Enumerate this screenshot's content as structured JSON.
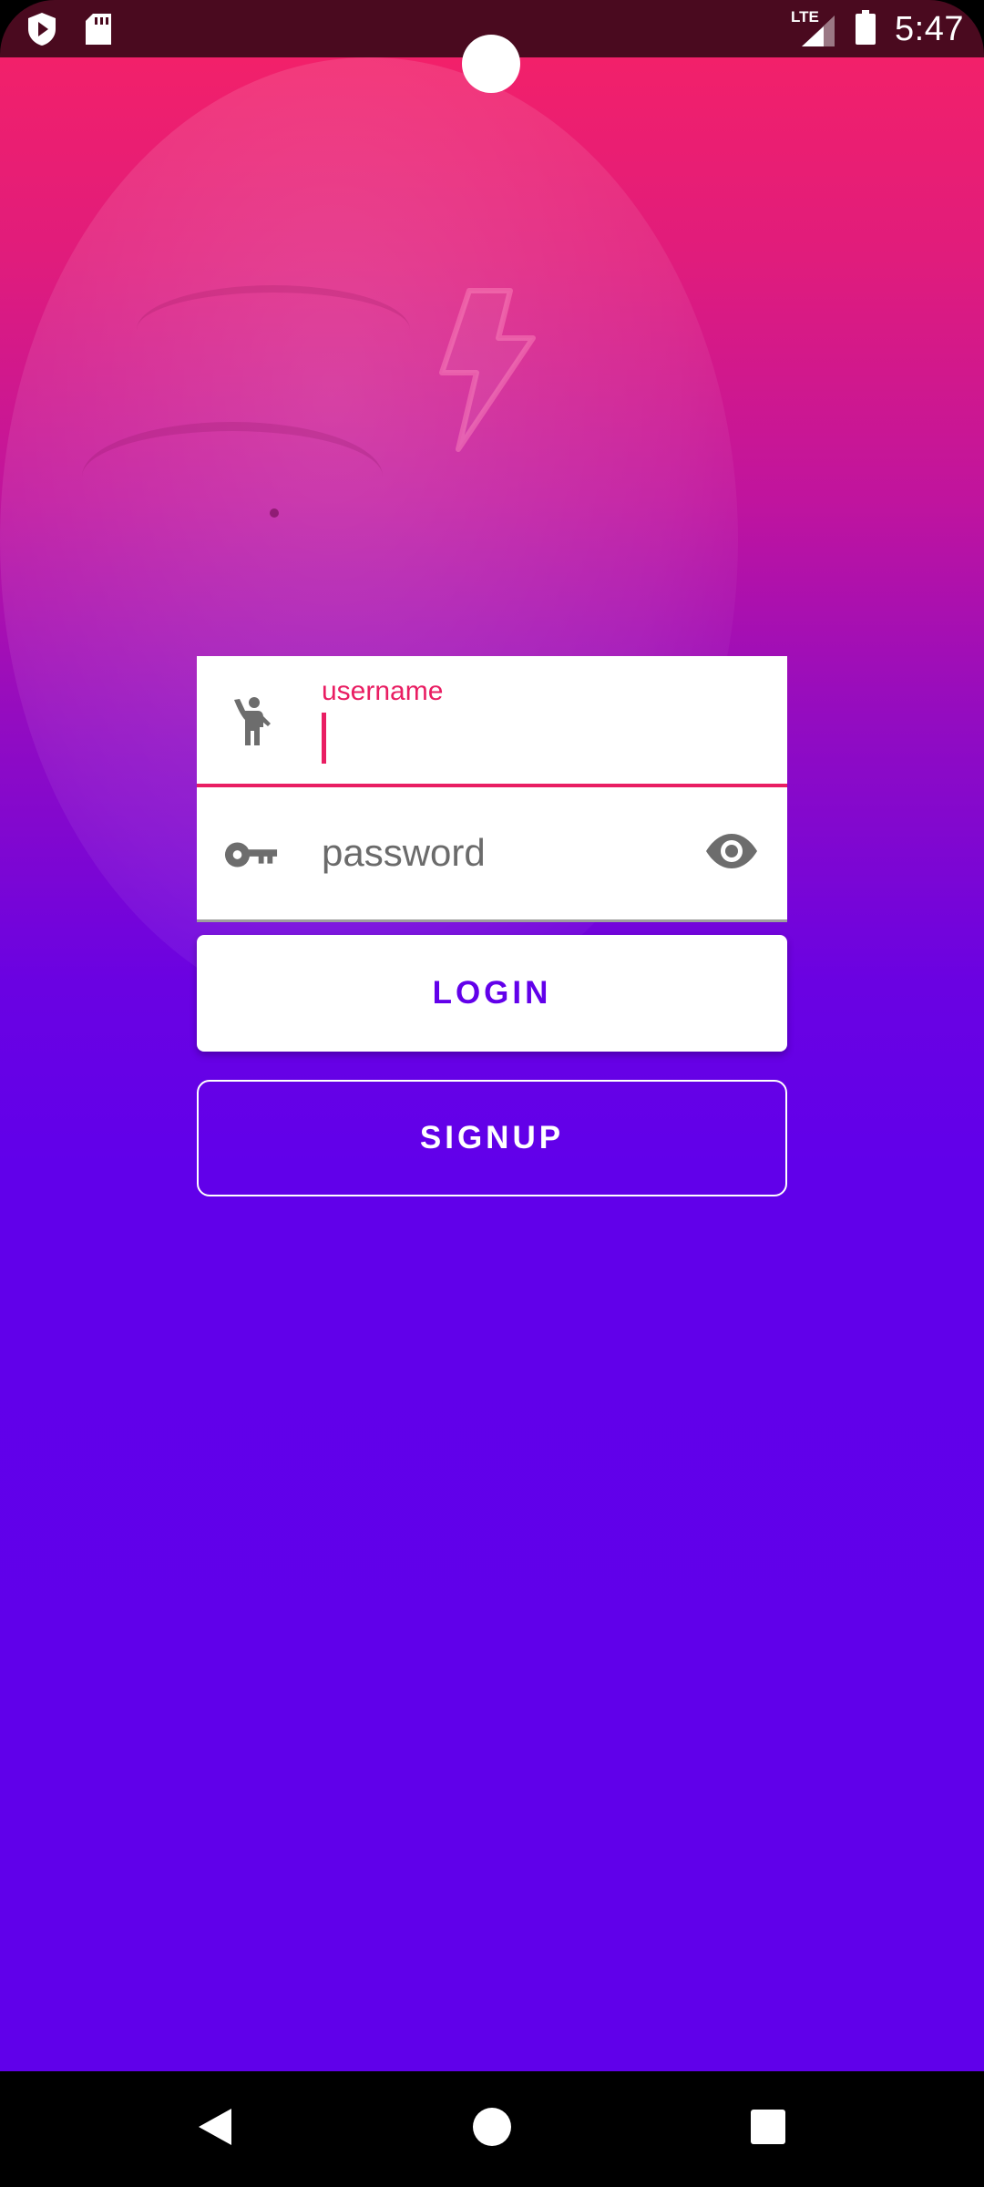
{
  "status_bar": {
    "time": "5:47",
    "network": "LTE",
    "icons": [
      "shield-play-icon",
      "sd-card-icon",
      "signal-icon",
      "battery-icon"
    ]
  },
  "background": {
    "icons": [
      "lightning-bolt-icon"
    ]
  },
  "form": {
    "username": {
      "label": "username",
      "value": "",
      "icon": "person-waving-icon"
    },
    "password": {
      "placeholder": "password",
      "value": "",
      "icon": "key-icon",
      "toggle_icon": "eye-icon"
    },
    "login_label": "LOGIN",
    "signup_label": "SIGNUP"
  },
  "nav_bar": {
    "icons": [
      "back-icon",
      "home-icon",
      "recents-icon"
    ]
  },
  "colors": {
    "accent_pink": "#e91e63",
    "primary_purple": "#6200ea",
    "status_bar": "#4a0a1f",
    "gradient_top": "#f2206a",
    "gradient_bottom": "#6000ea"
  }
}
